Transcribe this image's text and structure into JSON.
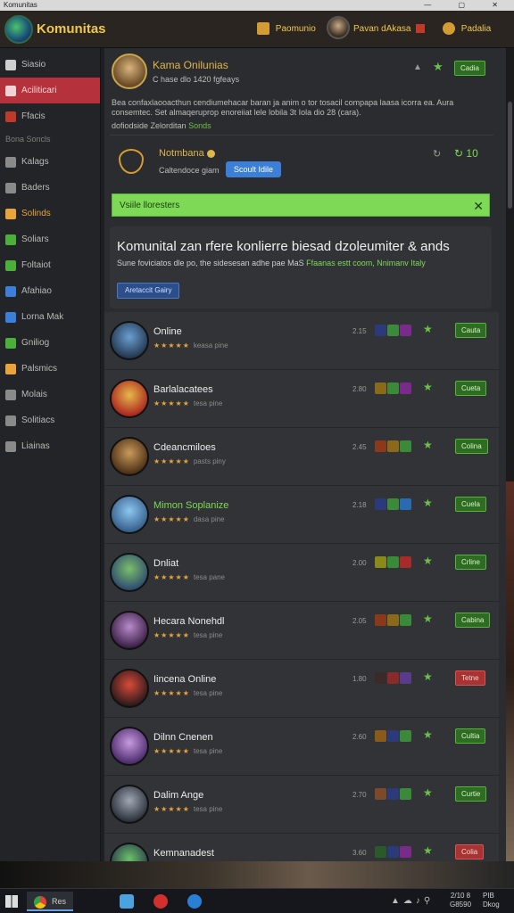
{
  "os_title": "Komunitas",
  "header": {
    "title": "Komunitas",
    "btn1": "Paomunio",
    "btn2": "Pavan dAkasa",
    "btn3": "Padalia"
  },
  "sidebar": {
    "items": [
      {
        "label": "Siasio",
        "icon": "image-icon"
      },
      {
        "label": "Aciliticari",
        "icon": "inbox-icon",
        "active": true
      },
      {
        "label": "Ffacis",
        "icon": "flag-icon"
      },
      {
        "label": "Kalags",
        "icon": "tag-icon"
      },
      {
        "label": "Baders",
        "icon": "badge-icon"
      },
      {
        "label": "Solinds",
        "icon": "sound-icon"
      },
      {
        "label": "Soliars",
        "icon": "bookmark-icon"
      },
      {
        "label": "Foltaiot",
        "icon": "folder-icon"
      },
      {
        "label": "Afahiao",
        "icon": "pen-icon"
      },
      {
        "label": "Lorna Mak",
        "icon": "market-icon"
      },
      {
        "label": "Gniliog",
        "icon": "arrow-icon"
      },
      {
        "label": "Palsmics",
        "icon": "grid-icon"
      },
      {
        "label": "Molais",
        "icon": "calendar-icon"
      },
      {
        "label": "Solitiacs",
        "icon": "settings-icon"
      },
      {
        "label": "Liainas",
        "icon": "user-icon"
      }
    ],
    "section_label": "Bona Soncls"
  },
  "profile": {
    "name": "Kama Onilunias",
    "sub": "C hase dlo 1420 fgfeays",
    "desc": "Bea confaxlaooacthun cendiumehacar baran ja anim o tor tosacil compapa laasa icorra ea. Aura consemtec. Set almaqeruprop enoreiiat lele lobila 3t Iola dio 28 (cara).",
    "note_prefix": "dofiodside Zelorditan",
    "note_link": "Sonds",
    "btn": "Cadia"
  },
  "notice": {
    "title": "Notmbana",
    "text": "Caltendoce giam",
    "btn": "Scoult Idile",
    "count": "10"
  },
  "banner": {
    "text": "Vsiile lloresters"
  },
  "promo": {
    "title": "Komunital zan rfere konlierre biesad dzoleumiter & ands",
    "sub_prefix": "Sune foviciatos dle po, the sidesesan adhe pae MaS",
    "sub_link": "Ffaanas estt coom,  Nnimanv Italy",
    "btn": "Aretaccit Gairy"
  },
  "games": [
    {
      "name": "Online",
      "stars": "★★★★★",
      "sub": "keasa pine",
      "score": "2.15",
      "btn": "Cauta",
      "btn_color": "green",
      "name_color": "white",
      "avatar": [
        "#6a9fd1",
        "#23364e"
      ]
    },
    {
      "name": "Barlalacatees",
      "stars": "★★★★★",
      "sub": "tesa pine",
      "score": "2.80",
      "btn": "Cueta",
      "btn_color": "green",
      "name_color": "white",
      "avatar": [
        "#e8b84a",
        "#a8251f"
      ]
    },
    {
      "name": "Cdeancmiloes",
      "stars": "★★★★★",
      "sub": "pasts piny",
      "score": "2.45",
      "btn": "Colina",
      "btn_color": "green",
      "name_color": "white",
      "avatar": [
        "#c99a5a",
        "#4a2e15"
      ]
    },
    {
      "name": "Mimon Soplanize",
      "stars": "★★★★★",
      "sub": "dasa pine",
      "score": "2.18",
      "btn": "Cuela",
      "btn_color": "green",
      "name_color": "green",
      "avatar": [
        "#8dc7f0",
        "#355d8a"
      ]
    },
    {
      "name": "Dnliat",
      "stars": "★★★★★",
      "sub": "tesa pane",
      "score": "2.00",
      "btn": "Crline",
      "btn_color": "green",
      "name_color": "white",
      "avatar": [
        "#7bbf6a",
        "#2e4a6f"
      ]
    },
    {
      "name": "Hecara Nonehdl",
      "stars": "★★★★★",
      "sub": "tesa pine",
      "score": "2.05",
      "btn": "Cabina",
      "btn_color": "green",
      "name_color": "white",
      "avatar": [
        "#b98acb",
        "#3a1f45"
      ]
    },
    {
      "name": "Iincena Online",
      "stars": "★★★★★",
      "sub": "tesa pine",
      "score": "1.80",
      "btn": "Tetne",
      "btn_color": "red",
      "name_color": "white",
      "avatar": [
        "#d94a3a",
        "#2b1a1a"
      ]
    },
    {
      "name": "Dilnn Cnenen",
      "stars": "★★★★★",
      "sub": "tesa pine",
      "score": "2.60",
      "btn": "Cultia",
      "btn_color": "green",
      "name_color": "white",
      "avatar": [
        "#c89ae0",
        "#4a2a6a"
      ]
    },
    {
      "name": "Dalim Ange",
      "stars": "★★★★★",
      "sub": "tesa pine",
      "score": "2.70",
      "btn": "Curtie",
      "btn_color": "green",
      "name_color": "white",
      "avatar": [
        "#a0a8b5",
        "#2a2f38"
      ]
    },
    {
      "name": "Kemnanadest",
      "stars": "★★★★★",
      "sub": "tesa pine",
      "score": "3.60",
      "btn": "Colia",
      "btn_color": "red",
      "name_color": "white",
      "avatar": [
        "#6ac26a",
        "#2b3a4a"
      ]
    }
  ],
  "taskbar": {
    "app_label": "Res",
    "clock_time": "2/10 8",
    "clock_date": "G8590",
    "lang_top": "PIB",
    "lang_bottom": "Dkog"
  }
}
